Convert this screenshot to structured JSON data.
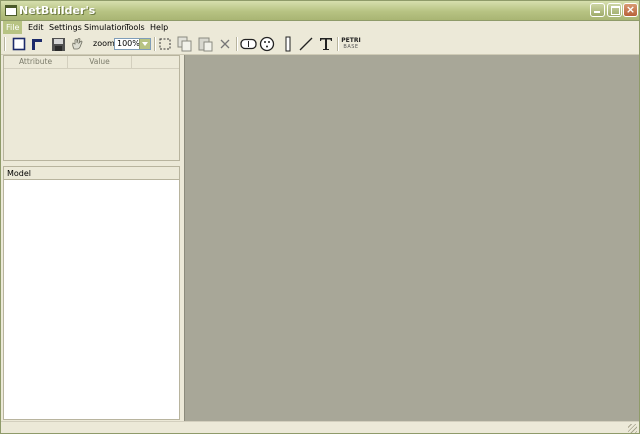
{
  "window": {
    "title": "NetBuilder's"
  },
  "menu": [
    {
      "label": "File",
      "active": true
    },
    {
      "label": "Edit"
    },
    {
      "label": "Settings"
    },
    {
      "label": "Simulation"
    },
    {
      "label": "Tools"
    },
    {
      "label": "Help"
    }
  ],
  "toolbar": {
    "zoom_label": "zoom:",
    "zoom_value": "100%",
    "tools": [
      "new-icon",
      "open-icon",
      "save-icon",
      "hand-icon",
      "select-icon",
      "copy-icon",
      "paste-icon",
      "delete-icon",
      "transition-icon",
      "place-icon",
      "bar-icon",
      "arc-icon",
      "text-icon",
      "petri-logo"
    ],
    "petri_text_line1": "PETRI",
    "petri_text_line2": "BASE"
  },
  "attributes_panel": {
    "columns": [
      "Attribute",
      "Value"
    ]
  },
  "model_panel": {
    "title": "Model"
  },
  "colors": {
    "titlebar": "#b7c383",
    "canvas": "#a8a798",
    "chrome": "#ece9d8"
  }
}
